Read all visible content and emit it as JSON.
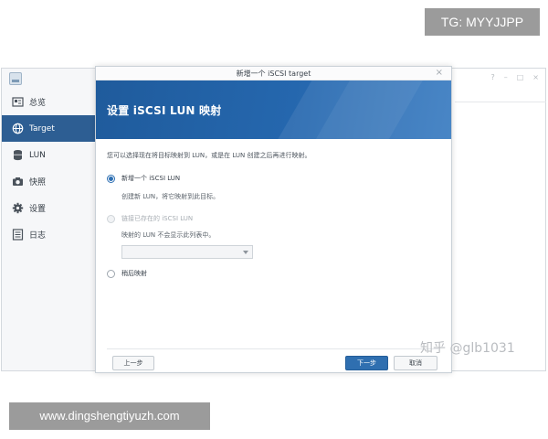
{
  "overlay": {
    "tg_label": "TG: MYYJJPP",
    "url_label": "www.dingshengtiyuzh.com",
    "watermark": "知乎 @glb1031"
  },
  "sidebar": {
    "items": [
      {
        "label": "总览",
        "icon": "overview-icon",
        "active": false
      },
      {
        "label": "Target",
        "icon": "globe-icon",
        "active": true
      },
      {
        "label": "LUN",
        "icon": "database-icon",
        "active": false
      },
      {
        "label": "快照",
        "icon": "camera-icon",
        "active": false
      },
      {
        "label": "设置",
        "icon": "gear-icon",
        "active": false
      },
      {
        "label": "日志",
        "icon": "log-icon",
        "active": false
      }
    ]
  },
  "dialog": {
    "title": "新增一个 iSCSI target",
    "close_glyph": "×",
    "banner_title": "设置 iSCSI LUN 映射",
    "description": "您可以选择现在将目标映射到 LUN，或是在 LUN 创建之后再进行映射。",
    "options": [
      {
        "label": "新增一个 iSCSI LUN",
        "checked": true,
        "disabled": false,
        "sub": "创建新 LUN，将它映射到此目标。"
      },
      {
        "label": "链接已存在的 iSCSI LUN",
        "checked": false,
        "disabled": true,
        "sub": "映射的 LUN 不会显示此列表中。"
      },
      {
        "label": "稍后映射",
        "checked": false,
        "disabled": false
      }
    ],
    "select_value": "",
    "buttons": {
      "prev": "上一步",
      "next": "下一步",
      "cancel": "取消"
    }
  },
  "colors": {
    "accent": "#2d5e93",
    "banner": "#2567ae",
    "primary_button": "#2f6fb0"
  }
}
